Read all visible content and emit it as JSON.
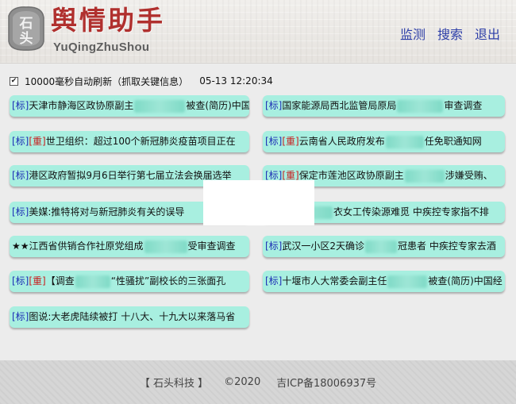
{
  "header": {
    "logo_glyph": "石头",
    "brand_title": "舆情助手",
    "brand_subtitle": "YuQingZhuShou",
    "nav": [
      {
        "label": "监测"
      },
      {
        "label": "搜索"
      },
      {
        "label": "退出"
      }
    ]
  },
  "status": {
    "checkbox_mark": "✔",
    "refresh_text": "10000毫秒自动刷新（抓取关键信息）",
    "timestamp": "05-13 12:20:34"
  },
  "tags": {
    "standard": "[标]",
    "important": "[重]",
    "stars": "★★"
  },
  "news": {
    "left": [
      {
        "pre": "天津市静海区政协原副主",
        "post": "被查(简历)中国"
      },
      {
        "pre": "世卫组织：超过100个新冠肺炎疫苗项目正在",
        "post": ""
      },
      {
        "pre": "港区政府暂拟9月6日举行第七届立法会换届选举",
        "post": ""
      },
      {
        "pre": "美媒:推特将对与新冠肺炎有关的误导",
        "post": ""
      },
      {
        "pre": "江西省供销合作社原党组成",
        "post": "受审查调查"
      },
      {
        "pre": "【调查",
        "post": "“性骚扰”副校长的三张面孔"
      },
      {
        "pre": "图说:大老虎陆续被打 十八大、十九大以来落马省",
        "post": ""
      }
    ],
    "right": [
      {
        "pre": "国家能源局西北监管局原局",
        "post": "审查调查"
      },
      {
        "pre": "云南省人民政府发布",
        "post": "任免职通知网"
      },
      {
        "pre": "保定市莲池区政协原副主",
        "post": "涉嫌受贿、"
      },
      {
        "pre": "",
        "post": "衣女工传染源难觅 中疾控专家指不排"
      },
      {
        "pre": "武汉一小区2天确诊",
        "post": "冠患者 中疾控专家去酒"
      },
      {
        "pre": "十堰市人大常委会副主任",
        "post": "被查(简历)中国经"
      }
    ]
  },
  "footer": {
    "company": "【 石头科技 】",
    "copyright": "©2020",
    "icp": "吉ICP备18006937号"
  }
}
